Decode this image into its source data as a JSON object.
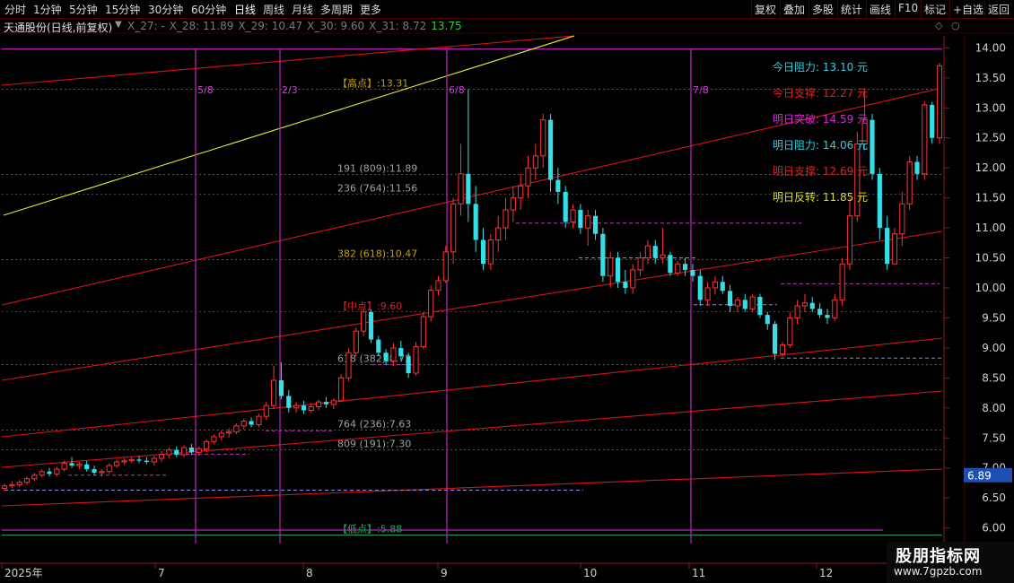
{
  "toolbar_left": [
    {
      "key": "fenshi",
      "label": "分时"
    },
    {
      "key": "m1",
      "label": "1分钟"
    },
    {
      "key": "m5",
      "label": "5分钟"
    },
    {
      "key": "m15",
      "label": "15分钟"
    },
    {
      "key": "m30",
      "label": "30分钟"
    },
    {
      "key": "m60",
      "label": "60分钟"
    },
    {
      "key": "day",
      "label": "日线",
      "active": true
    },
    {
      "key": "week",
      "label": "周线"
    },
    {
      "key": "month",
      "label": "月线"
    },
    {
      "key": "multi",
      "label": "多周期"
    },
    {
      "key": "more",
      "label": "更多"
    }
  ],
  "toolbar_right": [
    {
      "key": "restore",
      "label": "复权"
    },
    {
      "key": "overlay",
      "label": "叠加"
    },
    {
      "key": "multistock",
      "label": "多股"
    },
    {
      "key": "stats",
      "label": "统计"
    },
    {
      "key": "draw",
      "label": "画线"
    },
    {
      "key": "f10",
      "label": "F10"
    },
    {
      "key": "mark",
      "label": "标记"
    },
    {
      "key": "addfav",
      "label": "+自选"
    },
    {
      "key": "back",
      "label": "返回"
    }
  ],
  "title": {
    "stock": "天通股份(日线,前复权)",
    "indicators": [
      {
        "text": "X_27: -",
        "color": "#7a7a7a"
      },
      {
        "text": "X_28: 11.89",
        "color": "#7a7a7a"
      },
      {
        "text": "X_29: 10.47",
        "color": "#7a7a7a"
      },
      {
        "text": "X_30: 9.60",
        "color": "#7a7a7a"
      },
      {
        "text": "X_31: 8.72",
        "color": "#7a7a7a"
      },
      {
        "text": "13.75",
        "color": "#33cc33"
      }
    ]
  },
  "chart_data": {
    "type": "candlestick",
    "ylim": [
      5.8,
      14.2
    ],
    "y_ticks": [
      "14.00",
      "13.50",
      "13.00",
      "12.50",
      "12.00",
      "11.50",
      "11.00",
      "10.50",
      "10.00",
      "9.50",
      "9.00",
      "8.50",
      "8.00",
      "7.50",
      "7.00",
      "6.50",
      "6.00"
    ],
    "current_price_label": "6.89",
    "x_labels": [
      {
        "i": 0,
        "text": "2025年"
      },
      {
        "i": 20,
        "text": "7"
      },
      {
        "i": 41,
        "text": "8"
      },
      {
        "i": 61,
        "text": "9"
      },
      {
        "i": 80,
        "text": "10"
      },
      {
        "i": 95,
        "text": "11"
      },
      {
        "i": 113,
        "text": "12"
      }
    ],
    "vlines": [
      {
        "i": 26,
        "label": "5/8"
      },
      {
        "i": 37,
        "label": "2/3"
      },
      {
        "i": 60,
        "label": "6/8"
      },
      {
        "i": 93,
        "label": "7/8"
      }
    ],
    "fib_levels": [
      {
        "price": 13.31,
        "text": "【高点】:13.31",
        "color": "#c8a000"
      },
      {
        "price": 11.89,
        "text": "191 (809):11.89",
        "color": "#a0a0a0"
      },
      {
        "price": 11.56,
        "text": "236 (764):11.56",
        "color": "#a0a0a0"
      },
      {
        "price": 10.47,
        "text": "382 (618):10.47",
        "color": "#c8a000"
      },
      {
        "price": 9.6,
        "text": "【中点】:9.60",
        "color": "#cc2222"
      },
      {
        "price": 8.72,
        "text": "618 (382):8.72",
        "color": "#a0a0a0"
      },
      {
        "price": 7.63,
        "text": "764 (236):7.63",
        "color": "#a0a0a0"
      },
      {
        "price": 7.3,
        "text": "809 (191):7.30",
        "color": "#a0a0a0"
      },
      {
        "price": 5.88,
        "text": "【低点】:5.88",
        "color": "#22aa66"
      }
    ],
    "right_info": [
      {
        "text": "今日阻力: 13.10 元",
        "color": "#33ccdd"
      },
      {
        "text": "今日支撑: 12.27 元",
        "color": "#dd2222"
      },
      {
        "text": "明日突破: 14.59 元",
        "color": "#dd22dd"
      },
      {
        "text": "明日阻力: 14.06 元",
        "color": "#33ccdd"
      },
      {
        "text": "明日支撑: 12.69 元",
        "color": "#dd2222"
      },
      {
        "text": "明日反转: 11.85 元",
        "color": "#dddd22"
      }
    ],
    "candles": [
      [
        6.66,
        6.74,
        6.62,
        6.7
      ],
      [
        6.7,
        6.78,
        6.66,
        6.72
      ],
      [
        6.72,
        6.8,
        6.68,
        6.76
      ],
      [
        6.76,
        6.86,
        6.72,
        6.82
      ],
      [
        6.82,
        6.92,
        6.78,
        6.88
      ],
      [
        6.88,
        6.98,
        6.84,
        6.94
      ],
      [
        6.94,
        7.0,
        6.86,
        6.9
      ],
      [
        6.9,
        7.02,
        6.86,
        6.98
      ],
      [
        6.98,
        7.12,
        6.94,
        7.08
      ],
      [
        7.08,
        7.18,
        7.0,
        7.04
      ],
      [
        7.04,
        7.1,
        6.98,
        7.06
      ],
      [
        7.06,
        7.12,
        6.94,
        6.98
      ],
      [
        6.98,
        7.04,
        6.88,
        6.92
      ],
      [
        6.92,
        6.98,
        6.86,
        6.94
      ],
      [
        6.94,
        7.08,
        6.9,
        7.04
      ],
      [
        7.04,
        7.14,
        7.0,
        7.1
      ],
      [
        7.1,
        7.16,
        7.06,
        7.12
      ],
      [
        7.12,
        7.18,
        7.08,
        7.14
      ],
      [
        7.14,
        7.2,
        7.08,
        7.12
      ],
      [
        7.12,
        7.18,
        7.06,
        7.1
      ],
      [
        7.1,
        7.2,
        7.04,
        7.16
      ],
      [
        7.16,
        7.28,
        7.1,
        7.22
      ],
      [
        7.22,
        7.34,
        7.16,
        7.3
      ],
      [
        7.3,
        7.36,
        7.18,
        7.22
      ],
      [
        7.22,
        7.38,
        7.18,
        7.34
      ],
      [
        7.34,
        7.4,
        7.22,
        7.26
      ],
      [
        7.26,
        7.36,
        7.2,
        7.32
      ],
      [
        7.32,
        7.48,
        7.26,
        7.44
      ],
      [
        7.44,
        7.56,
        7.4,
        7.52
      ],
      [
        7.52,
        7.62,
        7.46,
        7.58
      ],
      [
        7.58,
        7.66,
        7.5,
        7.6
      ],
      [
        7.6,
        7.74,
        7.56,
        7.7
      ],
      [
        7.7,
        7.82,
        7.64,
        7.78
      ],
      [
        7.78,
        7.84,
        7.68,
        7.72
      ],
      [
        7.72,
        7.9,
        7.68,
        7.86
      ],
      [
        7.86,
        8.1,
        7.8,
        8.04
      ],
      [
        8.04,
        8.7,
        7.98,
        8.46
      ],
      [
        8.46,
        8.76,
        8.14,
        8.2
      ],
      [
        8.2,
        8.3,
        7.92,
        8.0
      ],
      [
        8.0,
        8.1,
        7.92,
        8.04
      ],
      [
        8.04,
        8.12,
        7.9,
        7.96
      ],
      [
        7.96,
        8.08,
        7.92,
        8.02
      ],
      [
        8.02,
        8.14,
        7.96,
        8.1
      ],
      [
        8.1,
        8.18,
        8.0,
        8.06
      ],
      [
        8.06,
        8.16,
        7.98,
        8.12
      ],
      [
        8.12,
        8.56,
        8.1,
        8.5
      ],
      [
        8.5,
        9.0,
        8.44,
        8.92
      ],
      [
        8.92,
        9.34,
        8.86,
        9.28
      ],
      [
        9.28,
        9.66,
        9.2,
        9.6
      ],
      [
        9.6,
        9.64,
        9.08,
        9.14
      ],
      [
        9.14,
        9.2,
        8.86,
        8.92
      ],
      [
        8.92,
        8.98,
        8.72,
        8.78
      ],
      [
        8.78,
        9.08,
        8.7,
        9.0
      ],
      [
        9.0,
        9.12,
        8.8,
        8.86
      ],
      [
        8.86,
        8.92,
        8.5,
        8.58
      ],
      [
        8.58,
        9.1,
        8.54,
        9.02
      ],
      [
        9.02,
        9.6,
        8.98,
        9.52
      ],
      [
        9.52,
        10.04,
        9.44,
        9.96
      ],
      [
        9.96,
        10.2,
        9.88,
        10.12
      ],
      [
        10.12,
        10.7,
        10.08,
        10.6
      ],
      [
        10.6,
        11.5,
        10.4,
        11.4
      ],
      [
        11.4,
        12.4,
        11.2,
        11.9
      ],
      [
        11.9,
        13.31,
        11.1,
        11.4
      ],
      [
        11.4,
        11.7,
        10.6,
        10.8
      ],
      [
        10.8,
        11.0,
        10.3,
        10.4
      ],
      [
        10.4,
        10.9,
        10.3,
        10.8
      ],
      [
        10.8,
        11.2,
        10.6,
        11.0
      ],
      [
        11.0,
        11.5,
        10.8,
        11.3
      ],
      [
        11.3,
        11.7,
        11.1,
        11.5
      ],
      [
        11.5,
        11.9,
        11.3,
        11.7
      ],
      [
        11.7,
        12.2,
        11.5,
        12.0
      ],
      [
        12.0,
        12.4,
        11.8,
        12.2
      ],
      [
        12.2,
        12.9,
        12.0,
        12.8
      ],
      [
        12.8,
        12.9,
        11.6,
        11.8
      ],
      [
        11.8,
        12.0,
        11.4,
        11.6
      ],
      [
        11.6,
        11.7,
        11.0,
        11.1
      ],
      [
        11.1,
        11.4,
        11.0,
        11.3
      ],
      [
        11.3,
        11.4,
        10.9,
        11.0
      ],
      [
        11.0,
        11.3,
        10.7,
        11.2
      ],
      [
        11.2,
        11.3,
        10.8,
        10.9
      ],
      [
        10.9,
        11.0,
        10.1,
        10.2
      ],
      [
        10.2,
        10.6,
        10.0,
        10.5
      ],
      [
        10.5,
        10.6,
        10.0,
        10.1
      ],
      [
        10.1,
        10.3,
        9.9,
        10.0
      ],
      [
        10.0,
        10.4,
        9.9,
        10.3
      ],
      [
        10.3,
        10.6,
        10.2,
        10.5
      ],
      [
        10.5,
        10.8,
        10.4,
        10.7
      ],
      [
        10.7,
        10.8,
        10.4,
        10.5
      ],
      [
        10.5,
        11.0,
        10.4,
        10.55
      ],
      [
        10.55,
        10.6,
        10.2,
        10.25
      ],
      [
        10.25,
        10.45,
        10.2,
        10.4
      ],
      [
        10.4,
        10.5,
        10.2,
        10.3
      ],
      [
        10.3,
        10.4,
        10.1,
        10.2
      ],
      [
        10.2,
        10.3,
        9.7,
        9.8
      ],
      [
        9.8,
        10.1,
        9.7,
        10.0
      ],
      [
        10.0,
        10.2,
        9.9,
        10.1
      ],
      [
        10.1,
        10.2,
        9.9,
        9.95
      ],
      [
        9.95,
        10.05,
        9.6,
        9.7
      ],
      [
        9.7,
        9.85,
        9.6,
        9.8
      ],
      [
        9.8,
        9.9,
        9.6,
        9.65
      ],
      [
        9.65,
        9.9,
        9.6,
        9.85
      ],
      [
        9.85,
        9.9,
        9.5,
        9.55
      ],
      [
        9.55,
        9.6,
        9.3,
        9.4
      ],
      [
        9.4,
        9.45,
        8.8,
        8.9
      ],
      [
        8.9,
        9.1,
        8.85,
        9.05
      ],
      [
        9.05,
        9.6,
        9.0,
        9.5
      ],
      [
        9.5,
        9.8,
        9.4,
        9.7
      ],
      [
        9.7,
        9.9,
        9.6,
        9.75
      ],
      [
        9.75,
        9.85,
        9.6,
        9.65
      ],
      [
        9.65,
        9.75,
        9.5,
        9.55
      ],
      [
        9.55,
        9.65,
        9.4,
        9.5
      ],
      [
        9.5,
        9.9,
        9.45,
        9.8
      ],
      [
        9.8,
        10.5,
        9.7,
        10.4
      ],
      [
        10.4,
        11.5,
        10.3,
        11.2
      ],
      [
        11.2,
        12.6,
        11.1,
        12.4
      ],
      [
        12.4,
        13.31,
        12.3,
        12.8
      ],
      [
        12.8,
        12.9,
        11.8,
        11.9
      ],
      [
        11.9,
        12.0,
        10.8,
        11.0
      ],
      [
        11.0,
        11.2,
        10.3,
        10.4
      ],
      [
        10.4,
        11.0,
        10.5,
        10.9
      ],
      [
        10.9,
        11.6,
        10.7,
        11.4
      ],
      [
        11.4,
        12.2,
        11.3,
        12.1
      ],
      [
        12.1,
        12.2,
        11.8,
        11.9
      ],
      [
        11.9,
        13.1,
        11.8,
        13.05
      ],
      [
        13.05,
        13.1,
        12.4,
        12.5
      ],
      [
        12.5,
        13.75,
        12.4,
        13.7
      ]
    ]
  }
}
